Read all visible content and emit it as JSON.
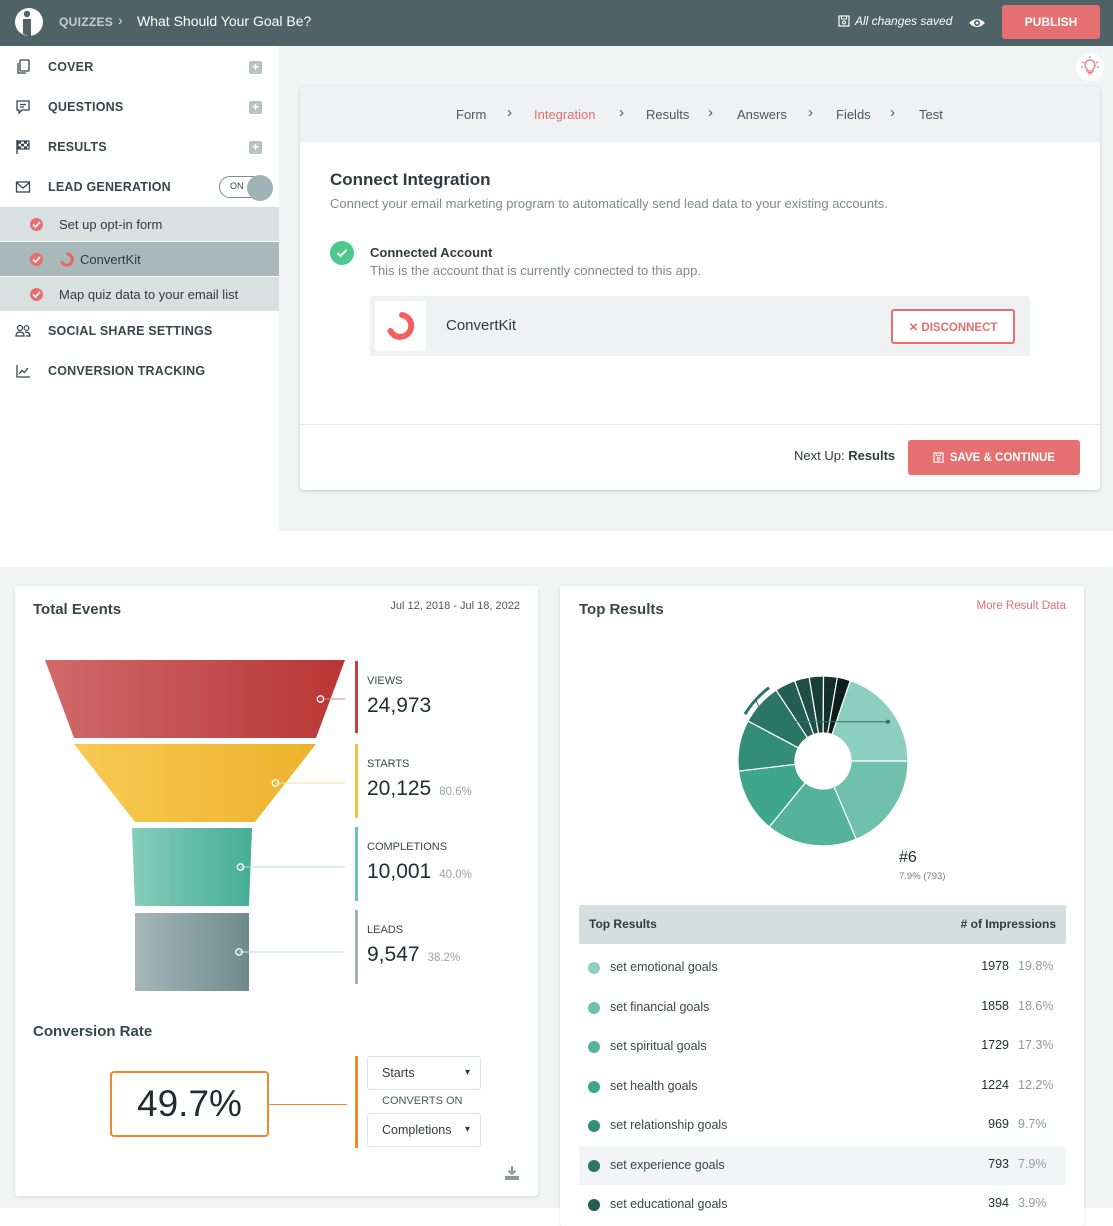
{
  "topbar": {
    "breadcrumb_root": "QUIZZES",
    "quiz_title": "What Should Your Goal Be?",
    "save_status": "All changes saved",
    "publish_label": "PUBLISH",
    "brand_color": "#e66f6f",
    "bar_color": "#4f6266"
  },
  "sidebar": {
    "items": [
      {
        "label": "COVER",
        "icon": "copy-pages-icon",
        "action": "add"
      },
      {
        "label": "QUESTIONS",
        "icon": "speech-bubble-icon",
        "action": "add"
      },
      {
        "label": "RESULTS",
        "icon": "checkered-flag-icon",
        "action": "add"
      },
      {
        "label": "LEAD GENERATION",
        "icon": "envelope-icon",
        "toggle": "ON"
      },
      {
        "label": "SOCIAL SHARE SETTINGS",
        "icon": "users-icon"
      },
      {
        "label": "CONVERSION TRACKING",
        "icon": "chart-trend-icon"
      }
    ],
    "lead_gen_subitems": [
      {
        "label": "Set up opt-in form",
        "checked": true
      },
      {
        "label": "ConvertKit",
        "checked": true,
        "active": true
      },
      {
        "label": "Map quiz data to your email list",
        "checked": true
      }
    ]
  },
  "wizard": {
    "steps": [
      "Form",
      "Integration",
      "Results",
      "Answers",
      "Fields",
      "Test"
    ],
    "active_step": "Integration",
    "title": "Connect Integration",
    "description": "Connect your email marketing program to automatically send lead data to your existing accounts.",
    "connected_title": "Connected Account",
    "connected_desc": "This is the account that is currently connected to this app.",
    "account_name": "ConvertKit",
    "disconnect_label": "DISCONNECT",
    "next_up_prefix": "Next Up:",
    "next_up_target": "Results",
    "save_continue_label": "SAVE & CONTINUE"
  },
  "total_events": {
    "title": "Total Events",
    "date_range": "Jul 12, 2018 - Jul 18, 2022",
    "stages": [
      {
        "label": "VIEWS",
        "value": "24,973",
        "pct": "",
        "color": "#c9403f"
      },
      {
        "label": "STARTS",
        "value": "20,125",
        "pct": "80.6%",
        "color": "#f4c043"
      },
      {
        "label": "COMPLETIONS",
        "value": "10,001",
        "pct": "40.0%",
        "color": "#6cc4b1"
      },
      {
        "label": "LEADS",
        "value": "9,547",
        "pct": "38.2%",
        "color": "#9fb1b3"
      }
    ]
  },
  "conversion_rate": {
    "title": "Conversion Rate",
    "value": "49.7%",
    "from_select": "Starts",
    "converts_on_label": "CONVERTS ON",
    "to_select": "Completions",
    "accent_color": "#f0892a"
  },
  "top_results": {
    "title": "Top Results",
    "more_link": "More Result Data",
    "callout_label": "#6",
    "callout_detail": "7.9% (793)",
    "table_header_left": "Top Results",
    "table_header_right": "# of Impressions",
    "rows": [
      {
        "name": "set emotional goals",
        "count": "1978",
        "pct": "19.8%",
        "color": "#8dcfbf"
      },
      {
        "name": "set financial goals",
        "count": "1858",
        "pct": "18.6%",
        "color": "#6fc0ac"
      },
      {
        "name": "set spiritual goals",
        "count": "1729",
        "pct": "17.3%",
        "color": "#55b39c"
      },
      {
        "name": "set health goals",
        "count": "1224",
        "pct": "12.2%",
        "color": "#3fa68a"
      },
      {
        "name": "set relationship goals",
        "count": "969",
        "pct": "9.7%",
        "color": "#338d76"
      },
      {
        "name": "set experience goals",
        "count": "793",
        "pct": "7.9%",
        "color": "#2b7565",
        "highlighted": true
      },
      {
        "name": "set educational goals",
        "count": "394",
        "pct": "3.9%",
        "color": "#245e52"
      }
    ]
  },
  "chart_data": [
    {
      "type": "bar",
      "title": "Total Events",
      "subtitle": "Jul 12, 2018 - Jul 18, 2022",
      "categories": [
        "VIEWS",
        "STARTS",
        "COMPLETIONS",
        "LEADS"
      ],
      "values": [
        24973,
        20125,
        10001,
        9547
      ],
      "percent_of_views": [
        100,
        80.6,
        40.0,
        38.2
      ]
    },
    {
      "type": "pie",
      "title": "Top Results",
      "labels": [
        "set emotional goals",
        "set financial goals",
        "set spiritual goals",
        "set health goals",
        "set relationship goals",
        "set experience goals",
        "set educational goals",
        "other-1",
        "other-2",
        "other-3",
        "other-4"
      ],
      "values": [
        19.8,
        18.6,
        17.3,
        12.2,
        9.7,
        7.9,
        3.9,
        2.8,
        2.7,
        2.6,
        2.5
      ],
      "colors": [
        "#8dcfbf",
        "#6fc0ac",
        "#55b39c",
        "#3fa68a",
        "#338d76",
        "#2b7565",
        "#245e52",
        "#1e4e44",
        "#183f37",
        "#13302a",
        "#0d1f1b"
      ],
      "highlighted": "set experience goals",
      "donut": true
    }
  ]
}
